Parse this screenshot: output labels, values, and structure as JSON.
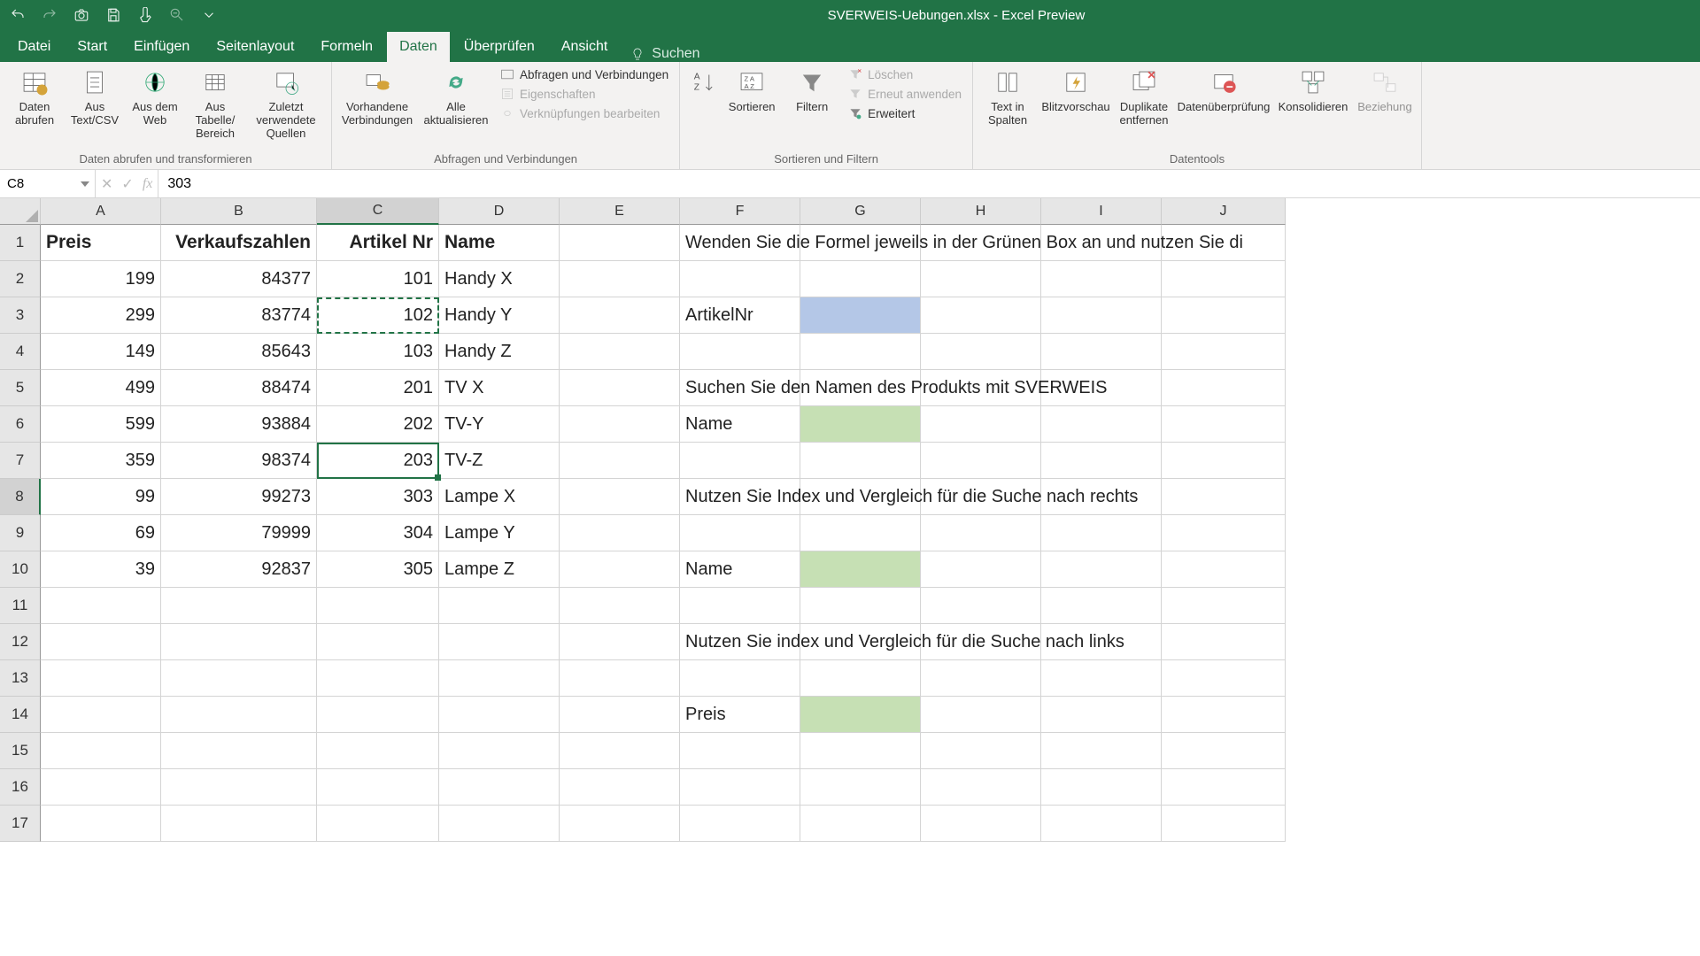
{
  "title": "SVERWEIS-Uebungen.xlsx - Excel Preview",
  "tabs": {
    "file": "Datei",
    "start": "Start",
    "einf": "Einfügen",
    "seite": "Seitenlayout",
    "formeln": "Formeln",
    "daten": "Daten",
    "ueber": "Überprüfen",
    "ansicht": "Ansicht"
  },
  "search_placeholder": "Suchen",
  "ribbon": {
    "g1": {
      "a": "Daten abrufen",
      "b": "Aus Text/CSV",
      "c": "Aus dem Web",
      "d": "Aus Tabelle/ Bereich",
      "e": "Zuletzt verwendete Quellen",
      "label": "Daten abrufen und transformieren"
    },
    "g2": {
      "a": "Vorhandene Verbindungen",
      "b": "Alle aktualisieren",
      "s1": "Abfragen und Verbindungen",
      "s2": "Eigenschaften",
      "s3": "Verknüpfungen bearbeiten",
      "label": "Abfragen und Verbindungen"
    },
    "g3": {
      "a": "Sortieren",
      "b": "Filtern",
      "s1": "Löschen",
      "s2": "Erneut anwenden",
      "s3": "Erweitert",
      "label": "Sortieren und Filtern"
    },
    "g4": {
      "a": "Text in Spalten",
      "b": "Blitzvorschau",
      "c": "Duplikate entfernen",
      "d": "Datenüberprüfung",
      "e": "Konsolidieren",
      "f": "Beziehung",
      "label": "Datentools"
    }
  },
  "namebox": "C8",
  "formula": "303",
  "cols": [
    "A",
    "B",
    "C",
    "D",
    "E",
    "F",
    "G",
    "H",
    "I",
    "J"
  ],
  "headers": {
    "A": "Preis",
    "B": "Verkaufszahlen",
    "C": "Artikel Nr",
    "D": "Name"
  },
  "data": [
    {
      "A": "199",
      "B": "84377",
      "C": "101",
      "D": "Handy X"
    },
    {
      "A": "299",
      "B": "83774",
      "C": "102",
      "D": "Handy Y"
    },
    {
      "A": "149",
      "B": "85643",
      "C": "103",
      "D": "Handy Z"
    },
    {
      "A": "499",
      "B": "88474",
      "C": "201",
      "D": "TV X"
    },
    {
      "A": "599",
      "B": "93884",
      "C": "202",
      "D": "TV-Y"
    },
    {
      "A": "359",
      "B": "98374",
      "C": "203",
      "D": "TV-Z"
    },
    {
      "A": "99",
      "B": "99273",
      "C": "303",
      "D": "Lampe X"
    },
    {
      "A": "69",
      "B": "79999",
      "C": "304",
      "D": "Lampe Y"
    },
    {
      "A": "39",
      "B": "92837",
      "C": "305",
      "D": "Lampe Z"
    }
  ],
  "fcol": {
    "f1": "Wenden Sie die Formel jeweils in der Grünen Box an und nutzen Sie di",
    "f3": "ArtikelNr",
    "f5": "Suchen Sie den Namen des Produkts mit SVERWEIS",
    "f6": "Name",
    "f8": "Nutzen Sie Index und Vergleich für die Suche nach rechts",
    "f10": "Name",
    "f12": "Nutzen Sie index und Vergleich für die Suche nach links",
    "f14": "Preis"
  }
}
